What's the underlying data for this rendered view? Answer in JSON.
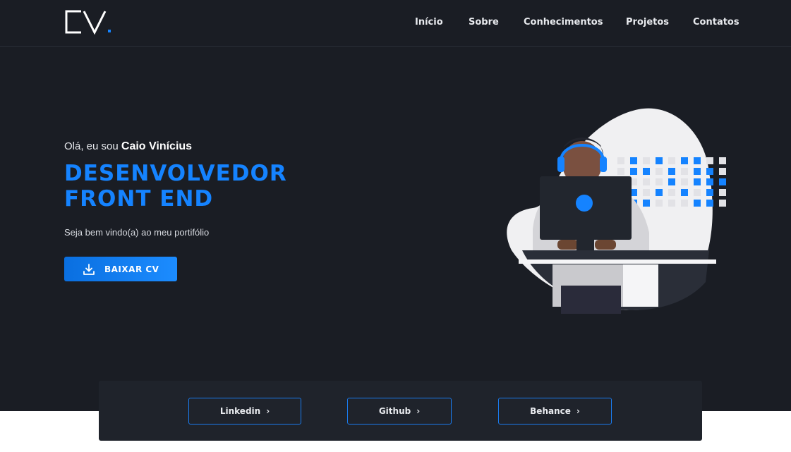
{
  "header": {
    "logo_alt": "CV.",
    "nav": [
      {
        "label": "Início"
      },
      {
        "label": "Sobre"
      },
      {
        "label": "Conhecimentos"
      },
      {
        "label": "Projetos"
      },
      {
        "label": "Contatos"
      }
    ]
  },
  "hero": {
    "greeting_prefix": "Olá, eu sou ",
    "greeting_name": "Caio Vinícius",
    "title_line1": "DESENVOLVEDOR",
    "title_line2": "FRONT END",
    "subtitle": "Seja bem vindo(a) ao meu portifólio",
    "download_label": "BAIXAR CV"
  },
  "social": {
    "linkedin": "Linkedin",
    "github": "Github",
    "behance": "Behance",
    "chevron": "›"
  },
  "colors": {
    "accent": "#1583ff",
    "background": "#1a1d24",
    "panel": "#1f232b"
  }
}
